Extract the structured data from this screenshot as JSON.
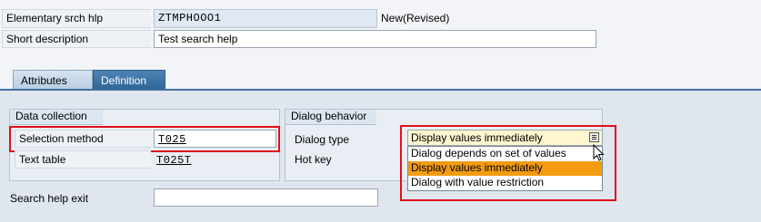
{
  "header": {
    "elementary_label": "Elementary srch hlp",
    "elementary_value": "ZTMPHOOO1",
    "status": "New(Revised)",
    "short_desc_label": "Short description",
    "short_desc_value": "Test search help"
  },
  "tabs": [
    {
      "label": "Attributes"
    },
    {
      "label": "Definition"
    }
  ],
  "data_collection": {
    "title": "Data collection",
    "selection_method_label": "Selection method",
    "selection_method_value": "T025",
    "text_table_label": "Text table",
    "text_table_value": "T025T"
  },
  "dialog_behavior": {
    "title": "Dialog behavior",
    "dialog_type_label": "Dialog type",
    "hot_key_label": "Hot key",
    "selected_value": "Display values immediately",
    "options": [
      "Dialog depends on set of values",
      "Display values immediately",
      "Dialog with value restriction"
    ]
  },
  "search_help_exit": {
    "label": "Search help exit",
    "value": ""
  },
  "colors": {
    "highlight": "#e0101a",
    "selected_option": "#f39c12",
    "tab_active": "#2f6497"
  }
}
